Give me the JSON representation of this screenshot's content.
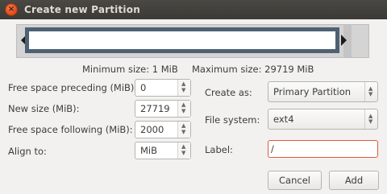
{
  "window": {
    "title": "Create new Partition",
    "close_glyph": "×"
  },
  "slider": {
    "arrow_left_icon": "triangle-left-icon",
    "arrow_right_icon": "triangle-right-icon"
  },
  "size_info": {
    "minimum": "Minimum size: 1 MiB",
    "maximum": "Maximum size: 29719 MiB"
  },
  "fields": {
    "free_before": {
      "label": "Free space preceding (MiB):",
      "value": "0"
    },
    "new_size": {
      "label": "New size (MiB):",
      "value": "27719"
    },
    "free_after": {
      "label": "Free space following (MiB):",
      "value": "2000"
    },
    "align_to": {
      "label": "Align to:",
      "value": "MiB"
    },
    "create_as": {
      "label": "Create as:",
      "value": "Primary Partition"
    },
    "file_system": {
      "label": "File system:",
      "value": "ext4"
    },
    "partition_label": {
      "label": "Label:",
      "value": "/"
    }
  },
  "buttons": {
    "cancel": "Cancel",
    "add": "Add"
  },
  "glyphs": {
    "up": "▲",
    "down": "▼"
  },
  "colors": {
    "titlebar": "#3c3b37",
    "close": "#df4a16",
    "partition_border": "#4d6172",
    "focus_border": "#e05a3a"
  }
}
